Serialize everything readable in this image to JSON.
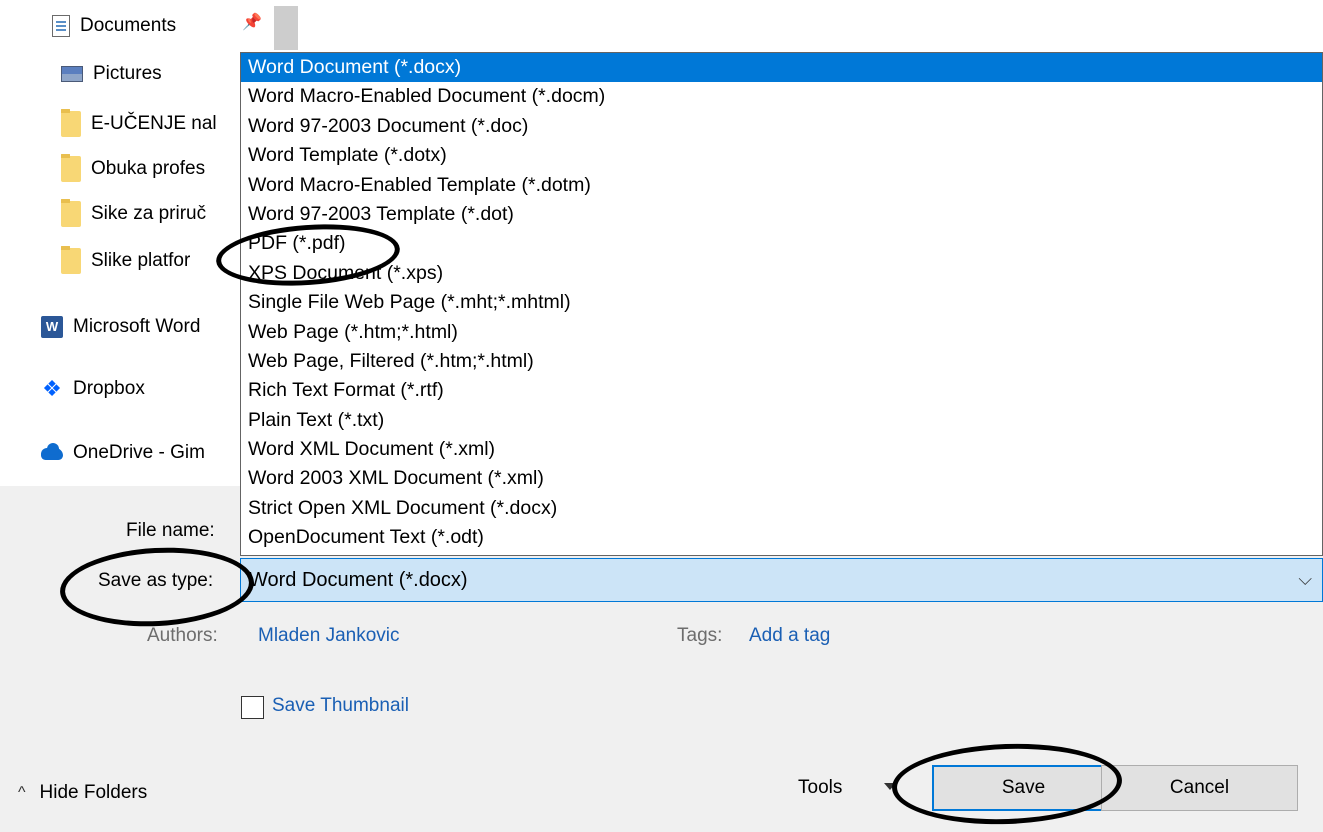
{
  "nav": {
    "items": [
      {
        "label": "Documents",
        "icon": "document-icon"
      },
      {
        "label": "Pictures",
        "icon": "pictures-icon"
      },
      {
        "label": "E-UČENJE nal",
        "icon": "folder-icon"
      },
      {
        "label": "Obuka profes",
        "icon": "folder-icon"
      },
      {
        "label": "Sike za priruč",
        "icon": "folder-icon"
      },
      {
        "label": "Slike platfor",
        "icon": "folder-icon"
      },
      {
        "label": "Microsoft Word",
        "icon": "word-icon"
      },
      {
        "label": "Dropbox",
        "icon": "dropbox-icon"
      },
      {
        "label": "OneDrive - Gim",
        "icon": "onedrive-icon"
      }
    ]
  },
  "file_types": {
    "selected": "Word Document (*.docx)",
    "options": [
      "Word Document (*.docx)",
      "Word Macro-Enabled Document (*.docm)",
      "Word 97-2003 Document (*.doc)",
      "Word Template (*.dotx)",
      "Word Macro-Enabled Template (*.dotm)",
      "Word 97-2003 Template (*.dot)",
      "PDF (*.pdf)",
      "XPS Document (*.xps)",
      "Single File Web Page (*.mht;*.mhtml)",
      "Web Page (*.htm;*.html)",
      "Web Page, Filtered (*.htm;*.html)",
      "Rich Text Format (*.rtf)",
      "Plain Text (*.txt)",
      "Word XML Document (*.xml)",
      "Word 2003 XML Document (*.xml)",
      "Strict Open XML Document (*.docx)",
      "OpenDocument Text (*.odt)"
    ]
  },
  "form": {
    "file_name_label": "File name:",
    "save_as_type_label": "Save as type:",
    "authors_label": "Authors:",
    "authors_value": "Mladen Jankovic",
    "tags_label": "Tags:",
    "tags_value": "Add a tag",
    "save_thumbnail_label": "Save Thumbnail",
    "save_thumbnail_checked": false
  },
  "footer": {
    "hide_folders": "Hide Folders",
    "tools": "Tools",
    "save": "Save",
    "cancel": "Cancel"
  },
  "colors": {
    "accent": "#0078d7",
    "selection_fill": "#cce4f7",
    "link": "#1a5fb4",
    "panel": "#f0f0f0"
  }
}
